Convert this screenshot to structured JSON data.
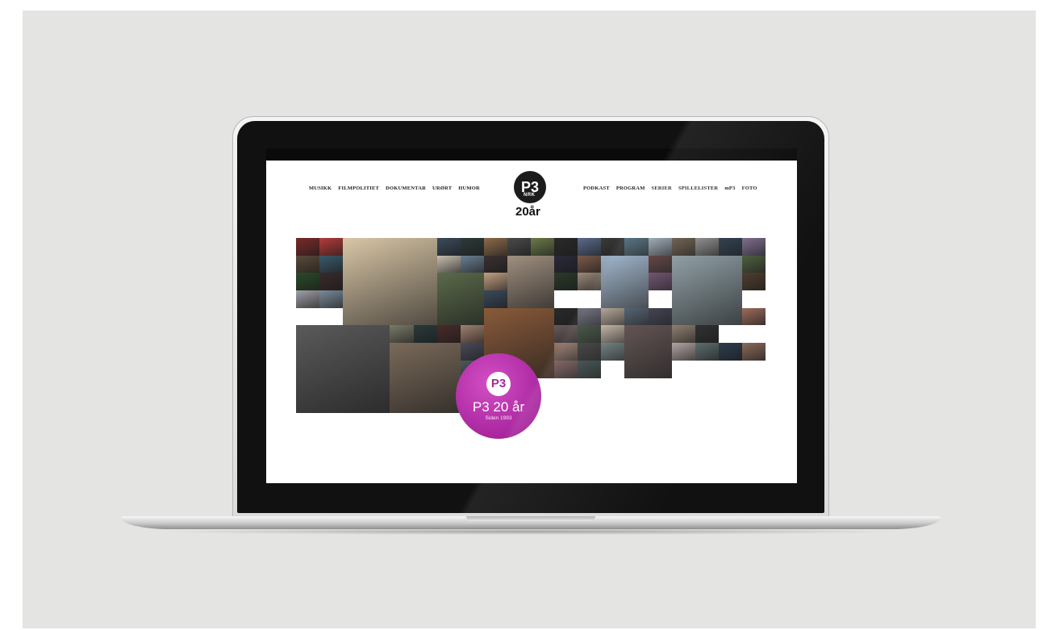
{
  "nav_left": [
    "MUSIKK",
    "FILMPOLITIET",
    "DOKUMENTAR",
    "URØRT",
    "HUMOR"
  ],
  "nav_right": [
    "PODKAST",
    "PROGRAM",
    "SERIER",
    "SPILLELISTER",
    "mP3",
    "FOTO"
  ],
  "logo": {
    "mark": "P3",
    "tag": "NRK",
    "years": "20år"
  },
  "badge": {
    "mark": "P3",
    "title": "P3 20 år",
    "subtitle": "Siden 1993",
    "color": "#a9269f"
  },
  "colors": {
    "backdrop": "#e4e4e3",
    "topbar": "#0a0a0a"
  },
  "tile_colors": [
    "#7a2a2a",
    "#b33b3b",
    "#d9c6a6",
    "#3b4b5b",
    "#2d3a3a",
    "#8a6a4a",
    "#4a4a4a",
    "#6a7a4a",
    "#2a2a2a",
    "#5a6a8a",
    "#3a3a3a",
    "#4a6a7a",
    "#9aa6b2",
    "#6a5a4a",
    "#8a8a8a",
    "#2a3a4a",
    "#7a6a8a",
    "#5a4a3a",
    "#3a5a6a",
    "#c8c0b0",
    "#6a7f92",
    "#3a3030",
    "#a09080",
    "#2a2a3a",
    "#7a5a4a",
    "#9ab0c8",
    "#5a3a3a",
    "#8a9aa0",
    "#4a5a3a",
    "#2a4a2a",
    "#3a2a2a",
    "#5a6a4a",
    "#c0a080",
    "#2a3a2a",
    "#9a8a7a",
    "#6a4a6a",
    "#4a3a2a",
    "#a0a0a8",
    "#7a8a9a",
    "#3a4a5a",
    "#8a5a3a",
    "#2a2a2a",
    "#6a6a7a",
    "#b0a090",
    "#4a5a6a",
    "#3a3a4a",
    "#9a6a5a",
    "#5a5a5a",
    "#7a7a6a",
    "#2a3a3a",
    "#4a2a2a",
    "#a08070",
    "#6a5a5a",
    "#3a4a3a",
    "#c0b0a0",
    "#5a4a4a",
    "#8a7a6a",
    "#2a2a2a",
    "#7a6a5a",
    "#4a4a5a",
    "#9a7a6a",
    "#3a3a3a",
    "#6a7a7a",
    "#b0a0a0",
    "#5a6a6a",
    "#2a3a4a",
    "#8a6a5a",
    "#4a5a5a",
    "#7a5a5a",
    "#3a4a4a"
  ]
}
